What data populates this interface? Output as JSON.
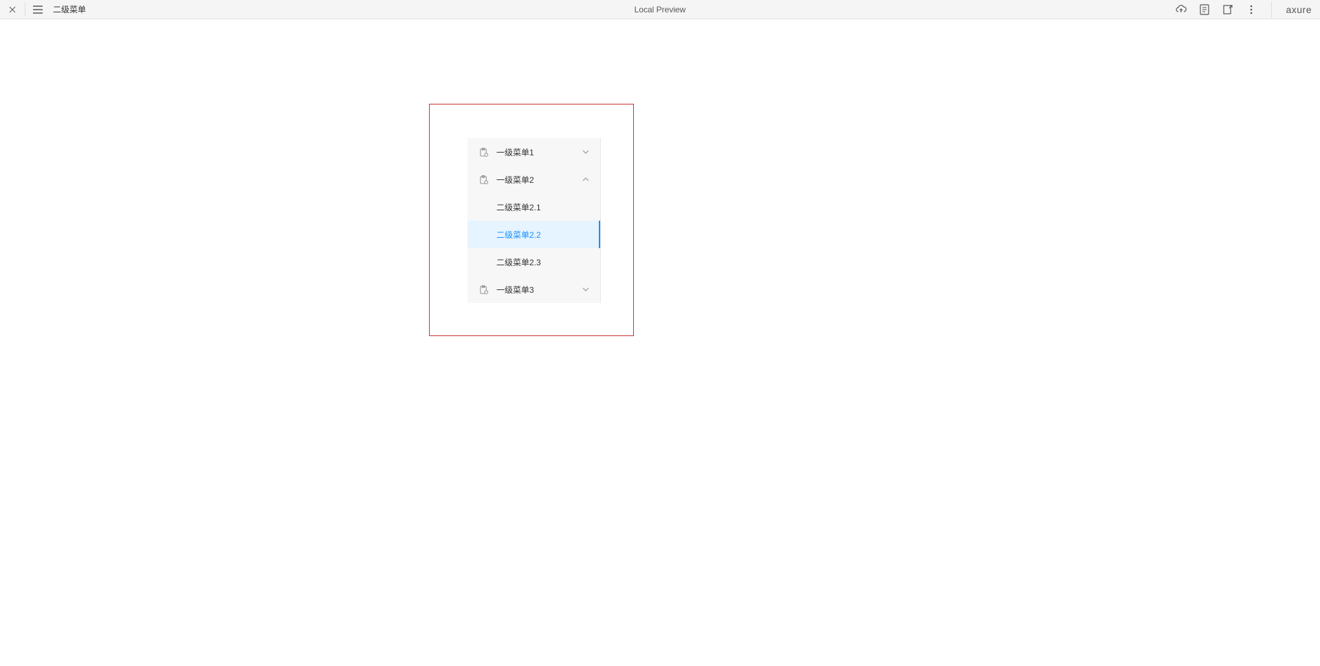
{
  "topbar": {
    "page_title": "二级菜单",
    "center_label": "Local Preview",
    "logo": "axure"
  },
  "menu": {
    "items": [
      {
        "label": "一级菜单1",
        "expanded": false
      },
      {
        "label": "一级菜单2",
        "expanded": true,
        "children": [
          {
            "label": "二级菜单2.1",
            "active": false
          },
          {
            "label": "二级菜单2.2",
            "active": true
          },
          {
            "label": "二级菜单2.3",
            "active": false
          }
        ]
      },
      {
        "label": "一级菜单3",
        "expanded": false
      }
    ]
  },
  "colors": {
    "accent": "#1890ff",
    "active_bg": "#e6f4ff",
    "red_border": "#c93030"
  }
}
